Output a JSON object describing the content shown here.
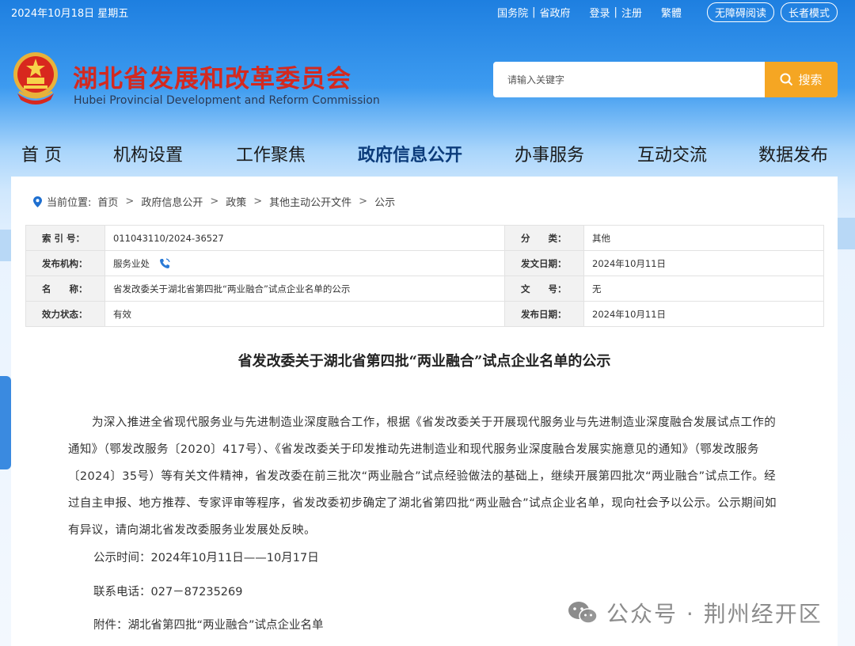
{
  "topbar": {
    "date": "2024年10月18日 星期五",
    "links": [
      "国务院",
      "省政府"
    ],
    "login": "登录",
    "register": "注册",
    "traditional": "繁體",
    "accessible": "无障碍阅读",
    "elder": "长者模式"
  },
  "header": {
    "title": "湖北省发展和改革委员会",
    "subtitle": "Hubei Provincial Development and Reform Commission"
  },
  "search": {
    "placeholder": "请输入关键字",
    "button": "搜索"
  },
  "nav": {
    "items": [
      "首 页",
      "机构设置",
      "工作聚焦",
      "政府信息公开",
      "办事服务",
      "互动交流",
      "数据发布"
    ],
    "active": "政府信息公开"
  },
  "breadcrumb": {
    "prefix": "当前位置:",
    "items": [
      "首页",
      "政府信息公开",
      "政策",
      "其他主动公开文件",
      "公示"
    ]
  },
  "meta": {
    "index_label": "索 引 号：",
    "index_value": "011043110/2024-36527",
    "category_label": "分　　类：",
    "category_value": "其他",
    "org_label": "发布机构：",
    "org_value": "服务业处",
    "issue_date_label": "发文日期：",
    "issue_date_value": "2024年10月11日",
    "name_label": "名　　称：",
    "name_value": "省发改委关于湖北省第四批“两业融合”试点企业名单的公示",
    "docno_label": "文　　号：",
    "docno_value": "无",
    "status_label": "效力状态：",
    "status_value": "有效",
    "publish_date_label": "发布日期：",
    "publish_date_value": "2024年10月11日"
  },
  "article": {
    "title": "省发改委关于湖北省第四批“两业融合”试点企业名单的公示",
    "paragraph": "为深入推进全省现代服务业与先进制造业深度融合工作，根据《省发改委关于开展现代服务业与先进制造业深度融合发展试点工作的通知》（鄂发改服务〔2020〕417号）、《省发改委关于印发推动先进制造业和现代服务业深度融合发展实施意见的通知》（鄂发改服务〔2024〕35号）等有关文件精神，省发改委在前三批次“两业融合”试点经验做法的基础上，继续开展第四批次“两业融合”试点工作。经过自主申报、地方推荐、专家评审等程序，省发改委初步确定了湖北省第四批“两业融合”试点企业名单，现向社会予以公示。公示期间如有异议，请向湖北省发改委服务业发展处反映。",
    "period": "公示时间：2024年10月11日——10月17日",
    "phone": "联系电话：027－87235269",
    "attachment": "附件：湖北省第四批“两业融合”试点企业名单"
  },
  "watermark": "公众号 · 荆州经开区",
  "colors": {
    "title_red": "#d32920",
    "search_orange": "#f5a623",
    "nav_active": "#0b3b7a"
  }
}
